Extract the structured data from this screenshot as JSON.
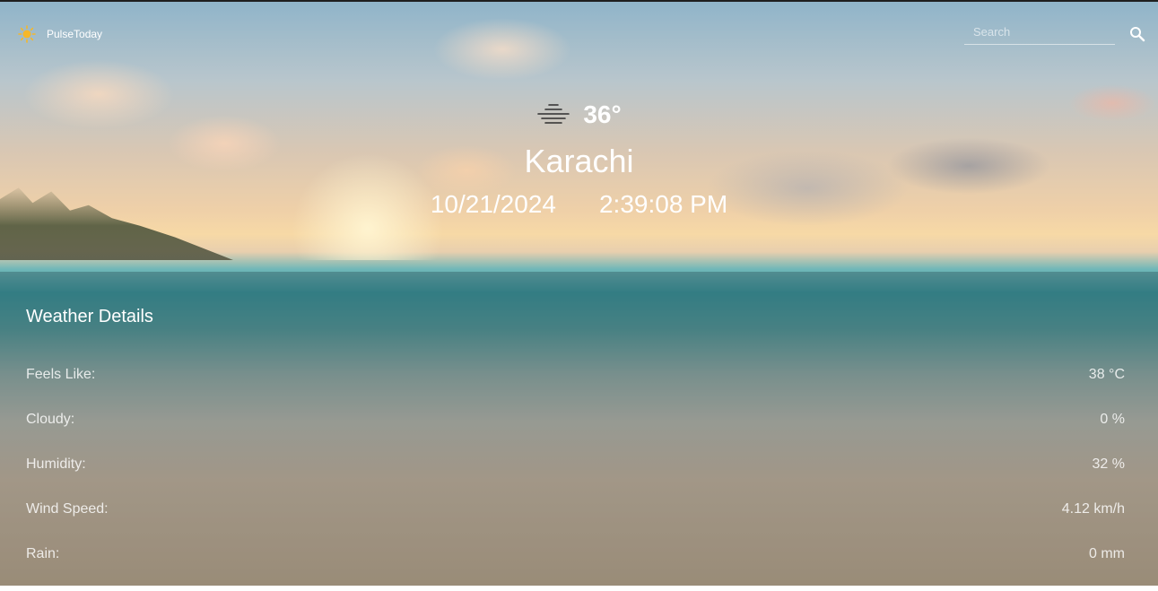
{
  "brand": {
    "name": "PulseToday",
    "icon": "sun-icon",
    "icon_color": "#f5b72a"
  },
  "search": {
    "placeholder": "Search",
    "button_icon": "search-icon"
  },
  "current": {
    "condition_icon": "haze-icon",
    "temperature": "36°",
    "city": "Karachi",
    "date": "10/21/2024",
    "time": "2:39:08 PM"
  },
  "details": {
    "title": "Weather Details",
    "rows": [
      {
        "label": "Feels Like:",
        "value": "38 °C"
      },
      {
        "label": "Cloudy:",
        "value": "0 %"
      },
      {
        "label": "Humidity:",
        "value": "32 %"
      },
      {
        "label": "Wind Speed:",
        "value": "4.12 km/h"
      },
      {
        "label": "Rain:",
        "value": "0 mm"
      }
    ]
  }
}
